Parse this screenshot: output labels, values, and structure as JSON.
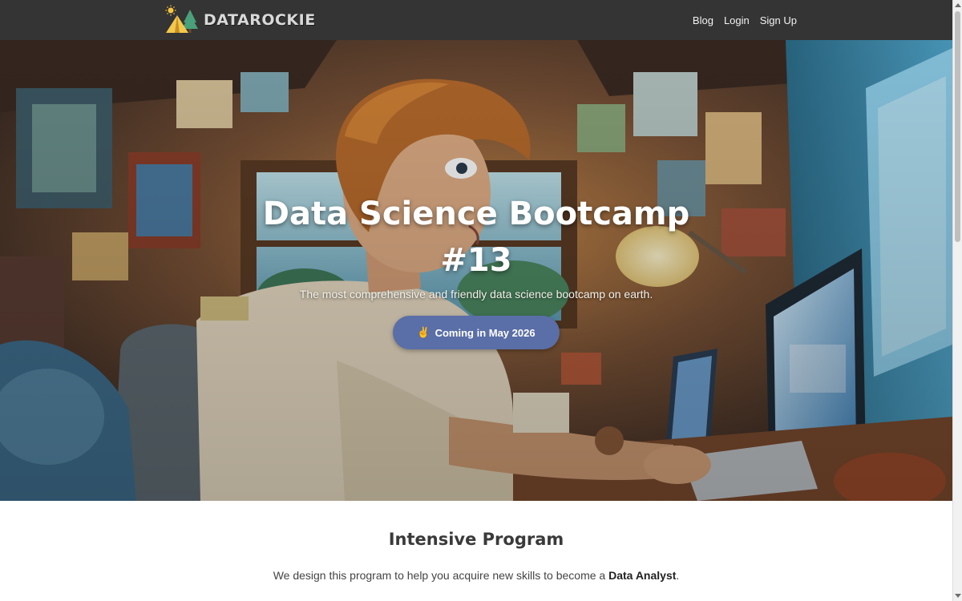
{
  "navbar": {
    "brand": "DATAROCKIE",
    "links": [
      "Blog",
      "Login",
      "Sign Up"
    ]
  },
  "hero": {
    "title_line1": "Data Science Bootcamp",
    "title_line2": "#13",
    "subtitle": "The most comprehensive and friendly data science bootcamp on earth.",
    "cta_icon": "clapping-hands-icon",
    "cta_label": "Coming in May 2026",
    "button_color": "#5a6ea7"
  },
  "section": {
    "title": "Intensive Program",
    "desc_prefix": "We design this program to help you acquire new skills to become a ",
    "desc_bold": "Data Analyst",
    "desc_suffix": "."
  },
  "colors": {
    "navbar_bg": "#343434",
    "accent": "#5a6ea7"
  }
}
